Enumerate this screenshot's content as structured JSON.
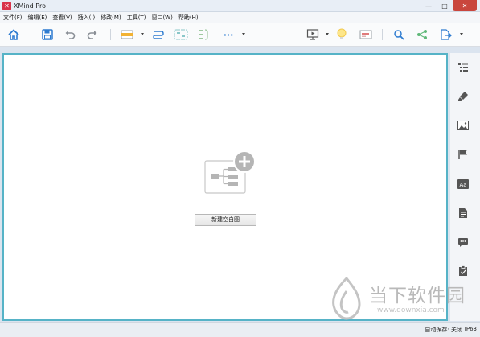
{
  "window": {
    "title": "XMind Pro",
    "logo_text": "✕",
    "controls": {
      "minimize": "—",
      "maximize": "□",
      "close": "✕"
    }
  },
  "menu": {
    "items": [
      "文件(F)",
      "编辑(E)",
      "查看(V)",
      "插入(I)",
      "修改(M)",
      "工具(T)",
      "窗口(W)",
      "帮助(H)"
    ]
  },
  "toolbar": {
    "icons": [
      "home-icon",
      "save-icon",
      "undo-icon",
      "redo-icon",
      "topic-style-icon",
      "relationship-icon",
      "boundary-icon",
      "summary-icon",
      "more-icon",
      "presentation-icon",
      "idea-icon",
      "gantt-icon",
      "search-icon",
      "share-icon",
      "export-icon"
    ],
    "more_label": "···"
  },
  "sidebar": {
    "icons": [
      "outline-icon",
      "format-brush-icon",
      "image-icon",
      "marker-flag-icon",
      "text-aa-icon",
      "notes-icon",
      "comments-icon",
      "task-icon"
    ],
    "text_label": "Aa"
  },
  "canvas": {
    "new_blank_button": "新建空白图"
  },
  "watermark": {
    "name": "当下软件园",
    "url": "www.downxia.com"
  },
  "status": {
    "autosave": "自动保存: 关闭",
    "ip": "IP63"
  },
  "colors": {
    "canvas_border": "#56b3c7",
    "close_button": "#c9463d",
    "app_logo": "#d9334a",
    "icon_blue": "#2d7bd0"
  }
}
